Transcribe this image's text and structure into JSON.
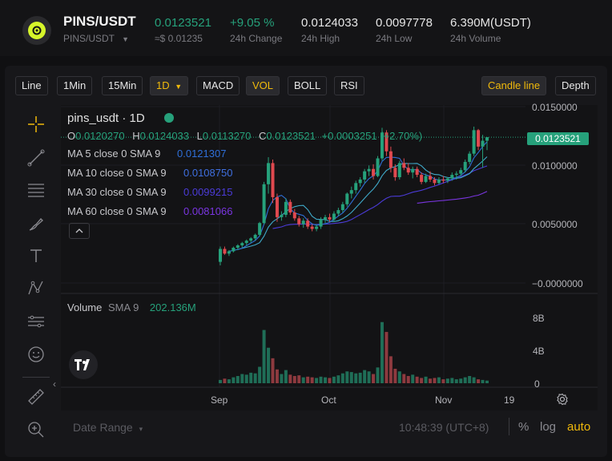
{
  "header": {
    "pair": "PINS/USDT",
    "subpair": "PINS/USDT",
    "last_price": "0.0123521",
    "usd_price": "≈$ 0.01235",
    "change": "+9.05 %",
    "change_label": "24h Change",
    "high": "0.0124033",
    "high_label": "24h High",
    "low": "0.0097778",
    "low_label": "24h Low",
    "volume": "6.390M(USDT)",
    "volume_label": "24h Volume"
  },
  "toolbar": {
    "line": "Line",
    "m1": "1Min",
    "m15": "15Min",
    "d1": "1D",
    "macd": "MACD",
    "vol": "VOL",
    "boll": "BOLL",
    "rsi": "RSI",
    "candle": "Candle line",
    "depth": "Depth"
  },
  "legend": {
    "title": "pins_usdt · 1D",
    "o_label": "O",
    "o": "0.0120270",
    "h_label": "H",
    "h": "0.0124033",
    "l_label": "L",
    "l": "0.0113270",
    "c_label": "C",
    "c": "0.0123521",
    "chg": "+0.0003251 (+2.70%)",
    "ma5_label": "MA  5 close 0 SMA 9",
    "ma5": "0.0121307",
    "ma10_label": "MA  10 close 0 SMA 9",
    "ma10": "0.0108750",
    "ma30_label": "MA  30 close 0 SMA 9",
    "ma30": "0.0099215",
    "ma60_label": "MA  60 close 0 SMA 9",
    "ma60": "0.0081066",
    "volume_label": "Volume",
    "volume_sma": "SMA 9",
    "volume_value": "202.136M"
  },
  "price_tag": "0.0123521",
  "price_axis": [
    "0.0150000",
    "0.0100000",
    "0.0050000",
    "−0.0000000"
  ],
  "volume_axis": [
    "8B",
    "4B",
    "0"
  ],
  "time_axis": [
    "Sep",
    "Oct",
    "Nov",
    "19"
  ],
  "bottom": {
    "date_range": "Date Range",
    "time": "10:48:39 (UTC+8)",
    "percent": "%",
    "log": "log",
    "auto": "auto"
  },
  "colors": {
    "up": "#26a17b",
    "down": "#e0494f",
    "accent": "#f0b90b",
    "ma5": "#2f6fd8",
    "ma10": "#3fa9c9",
    "ma30": "#4b3bd8",
    "ma60": "#7a35e0"
  },
  "chart_data": {
    "type": "candlestick",
    "x_ticks": [
      "Sep",
      "Oct",
      "Nov",
      "19"
    ],
    "ylim": [
      0,
      0.015
    ],
    "candles": [
      [
        0.0018,
        0.0031,
        0.0015,
        0.0029
      ],
      [
        0.0029,
        0.0031,
        0.0024,
        0.0025
      ],
      [
        0.0025,
        0.0028,
        0.0023,
        0.0027
      ],
      [
        0.0027,
        0.0031,
        0.0026,
        0.003
      ],
      [
        0.003,
        0.0033,
        0.0028,
        0.0032
      ],
      [
        0.0032,
        0.0035,
        0.003,
        0.0034
      ],
      [
        0.0034,
        0.0037,
        0.0032,
        0.0036
      ],
      [
        0.0036,
        0.0039,
        0.0034,
        0.0038
      ],
      [
        0.0038,
        0.0042,
        0.0036,
        0.0041
      ],
      [
        0.0041,
        0.0052,
        0.004,
        0.0051
      ],
      [
        0.0051,
        0.0086,
        0.005,
        0.0084
      ],
      [
        0.0084,
        0.0107,
        0.0076,
        0.0102
      ],
      [
        0.0102,
        0.0105,
        0.0068,
        0.0073
      ],
      [
        0.0073,
        0.0076,
        0.0052,
        0.0056
      ],
      [
        0.0056,
        0.0061,
        0.0053,
        0.0058
      ],
      [
        0.0058,
        0.0072,
        0.0056,
        0.0069
      ],
      [
        0.0069,
        0.0071,
        0.0058,
        0.006
      ],
      [
        0.006,
        0.0063,
        0.0053,
        0.0055
      ],
      [
        0.0055,
        0.0057,
        0.0048,
        0.005
      ],
      [
        0.005,
        0.0055,
        0.0047,
        0.0053
      ],
      [
        0.0053,
        0.0055,
        0.0046,
        0.0048
      ],
      [
        0.0048,
        0.005,
        0.0044,
        0.0046
      ],
      [
        0.0046,
        0.005,
        0.0044,
        0.0048
      ],
      [
        0.0048,
        0.0056,
        0.0046,
        0.0054
      ],
      [
        0.0054,
        0.0058,
        0.0051,
        0.0056
      ],
      [
        0.0056,
        0.0059,
        0.0052,
        0.0054
      ],
      [
        0.0054,
        0.0061,
        0.0052,
        0.0059
      ],
      [
        0.0059,
        0.0064,
        0.0057,
        0.0062
      ],
      [
        0.0062,
        0.0069,
        0.006,
        0.0067
      ],
      [
        0.0067,
        0.0077,
        0.0065,
        0.0076
      ],
      [
        0.0076,
        0.0082,
        0.0072,
        0.0079
      ],
      [
        0.0079,
        0.0087,
        0.0076,
        0.0085
      ],
      [
        0.0085,
        0.009,
        0.0082,
        0.0088
      ],
      [
        0.0088,
        0.0097,
        0.0085,
        0.0095
      ],
      [
        0.0095,
        0.01,
        0.0091,
        0.0097
      ],
      [
        0.0097,
        0.0101,
        0.0088,
        0.0091
      ],
      [
        0.0091,
        0.0108,
        0.009,
        0.0106
      ],
      [
        0.0106,
        0.0132,
        0.0104,
        0.0128
      ],
      [
        0.0128,
        0.013,
        0.0108,
        0.0112
      ],
      [
        0.0112,
        0.0116,
        0.0094,
        0.0098
      ],
      [
        0.0098,
        0.0101,
        0.0087,
        0.009
      ],
      [
        0.009,
        0.0104,
        0.0088,
        0.0102
      ],
      [
        0.0102,
        0.0106,
        0.0096,
        0.0098
      ],
      [
        0.0098,
        0.0102,
        0.0092,
        0.0094
      ],
      [
        0.0094,
        0.0099,
        0.0089,
        0.0097
      ],
      [
        0.0097,
        0.0099,
        0.009,
        0.0092
      ],
      [
        0.0092,
        0.0094,
        0.0084,
        0.0086
      ],
      [
        0.0086,
        0.0093,
        0.0085,
        0.0091
      ],
      [
        0.0091,
        0.0095,
        0.0086,
        0.0088
      ],
      [
        0.0088,
        0.009,
        0.0083,
        0.0085
      ],
      [
        0.0085,
        0.009,
        0.0084,
        0.0088
      ],
      [
        0.0088,
        0.0091,
        0.0085,
        0.0087
      ],
      [
        0.0087,
        0.009,
        0.0085,
        0.0089
      ],
      [
        0.0089,
        0.0094,
        0.0087,
        0.0092
      ],
      [
        0.0092,
        0.0095,
        0.0088,
        0.0093
      ],
      [
        0.0093,
        0.0098,
        0.0091,
        0.0096
      ],
      [
        0.0096,
        0.0105,
        0.0094,
        0.0103
      ],
      [
        0.0103,
        0.0112,
        0.0101,
        0.011
      ],
      [
        0.011,
        0.0133,
        0.0108,
        0.013
      ],
      [
        0.013,
        0.0131,
        0.0113,
        0.0116
      ],
      [
        0.0116,
        0.0126,
        0.0098,
        0.0121
      ],
      [
        0.0121,
        0.0124,
        0.0113,
        0.0124
      ]
    ],
    "volumes": [
      0.5,
      0.7,
      0.6,
      0.9,
      1.1,
      1.4,
      1.3,
      1.6,
      1.5,
      2.5,
      8.1,
      5.4,
      3.8,
      2.1,
      1.4,
      2.0,
      1.3,
      1.1,
      1.2,
      0.9,
      1.0,
      0.9,
      0.8,
      1.0,
      0.9,
      0.8,
      1.0,
      1.2,
      1.5,
      1.8,
      1.7,
      1.5,
      1.6,
      2.0,
      1.8,
      1.4,
      2.4,
      9.3,
      7.8,
      4.1,
      2.2,
      1.8,
      1.4,
      1.1,
      1.3,
      1.0,
      0.8,
      1.0,
      0.7,
      0.8,
      0.9,
      0.6,
      0.7,
      0.8,
      0.6,
      0.7,
      0.9,
      1.1,
      0.9,
      0.6,
      0.5,
      0.4
    ],
    "volume_ylim": [
      0,
      10
    ]
  }
}
